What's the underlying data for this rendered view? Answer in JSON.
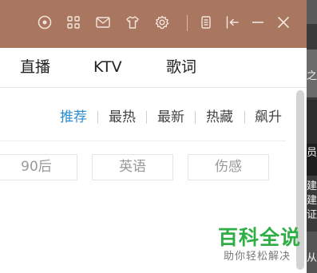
{
  "titlebar": {
    "icons": [
      "record-icon",
      "apps-grid-icon",
      "mail-icon",
      "skin-shirt-icon",
      "settings-gear-icon",
      "mini-player-icon",
      "exit-to-tray-icon",
      "minimize-icon",
      "close-icon"
    ],
    "background": "#a9765f"
  },
  "tabs": [
    {
      "label": "直播"
    },
    {
      "label": "KTV"
    },
    {
      "label": "歌词"
    }
  ],
  "filters": [
    {
      "label": "推荐",
      "active": true
    },
    {
      "label": "最热",
      "active": false
    },
    {
      "label": "最新",
      "active": false
    },
    {
      "label": "热藏",
      "active": false
    },
    {
      "label": "飙升",
      "active": false
    }
  ],
  "accent_color": "#2a8ccf",
  "tags": [
    {
      "label": "90后"
    },
    {
      "label": "英语"
    },
    {
      "label": "伤感"
    }
  ],
  "side_strip": {
    "texts": [
      "之",
      "员",
      "建",
      "建",
      "证",
      "从"
    ]
  },
  "watermark": {
    "title": "百科全说",
    "subtitle": "助你轻松解决",
    "color": "#2fae46"
  }
}
